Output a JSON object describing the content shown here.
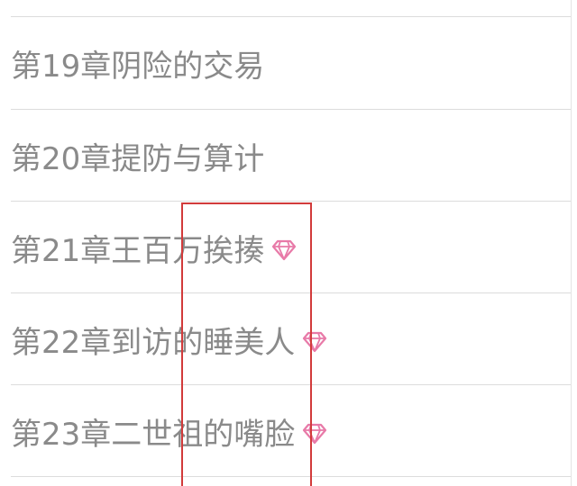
{
  "chapters": [
    {
      "title": "第19章阴险的交易",
      "vip": false
    },
    {
      "title": "第20章提防与算计",
      "vip": false
    },
    {
      "title": "第21章王百万挨揍",
      "vip": true,
      "icon": "diamond-icon"
    },
    {
      "title": "第22章到访的睡美人",
      "vip": true,
      "icon": "diamond-icon"
    },
    {
      "title": "第23章二世祖的嘴脸",
      "vip": true,
      "icon": "diamond-icon"
    }
  ],
  "colors": {
    "title_text": "#8a8a8a",
    "divider": "#dcdcdc",
    "vip_icon": "#e87aa8",
    "highlight_border": "#d23b3b"
  }
}
